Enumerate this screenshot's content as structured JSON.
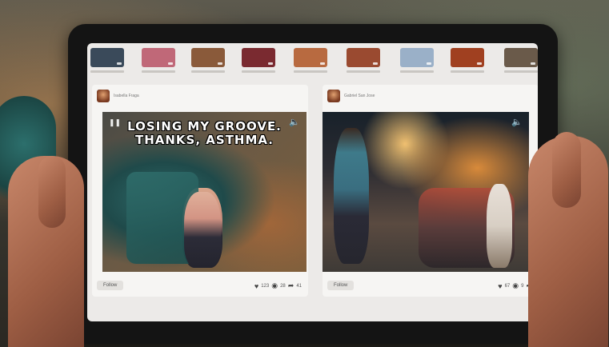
{
  "thumbnails": [
    {
      "color": "#3a4a5a"
    },
    {
      "color": "#c06878"
    },
    {
      "color": "#8a5a3a"
    },
    {
      "color": "#7a2a30"
    },
    {
      "color": "#b86a40"
    },
    {
      "color": "#9a4a30"
    },
    {
      "color": "#9ab0c8"
    },
    {
      "color": "#a04020"
    },
    {
      "color": "#6a5a4a"
    }
  ],
  "posts": [
    {
      "user": "Isabella Fraga",
      "meme_line1": "LOSING MY GROOVE.",
      "meme_line2": "THANKS, ASTHMA.",
      "follow_label": "Follow",
      "likes": "123",
      "comments": "28",
      "shares": "41"
    },
    {
      "user": "Gabriel San Jose",
      "follow_label": "Follow",
      "likes": "67",
      "comments": "9",
      "shares": ""
    }
  ],
  "icons": {
    "pause": "pause-icon",
    "sound": "speaker-icon",
    "like": "heart-icon",
    "comment": "comment-icon",
    "share": "share-arrow-icon"
  }
}
